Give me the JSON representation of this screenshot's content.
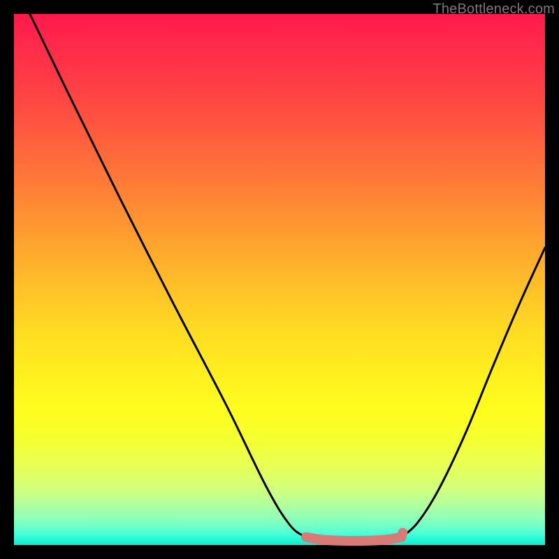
{
  "watermark": "TheBottleneck.com",
  "chart_data": {
    "type": "line",
    "title": "",
    "xlabel": "",
    "ylabel": "",
    "xlim": [
      0,
      100
    ],
    "ylim": [
      0,
      100
    ],
    "series": [
      {
        "name": "left-curve",
        "x": [
          3,
          10,
          20,
          30,
          40,
          47.5,
          52,
          55
        ],
        "values": [
          100,
          85.5,
          65.2,
          45.5,
          26.3,
          11,
          3.7,
          1.5
        ]
      },
      {
        "name": "right-curve",
        "x": [
          73,
          76,
          80,
          85,
          90,
          95,
          100
        ],
        "values": [
          1.5,
          4.2,
          10.5,
          21,
          33.2,
          45,
          56
        ]
      },
      {
        "name": "bottom-band",
        "x": [
          55,
          58,
          62,
          66,
          70,
          73
        ],
        "values": [
          1.5,
          1.0,
          0.8,
          0.8,
          1.0,
          1.5
        ]
      }
    ],
    "accent_dot": {
      "x": 73.2,
      "y": 2.3
    },
    "colors": {
      "curve": "#000000",
      "band": "#d87a78",
      "dot": "#d87a78"
    }
  }
}
